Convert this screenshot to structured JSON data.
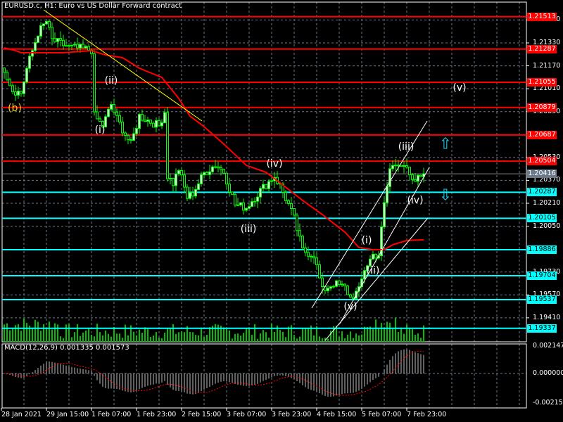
{
  "header": {
    "title": "EURUSD.c, H1:  Euro vs US Dollar Forward contract"
  },
  "macd_header": {
    "title": "MACD(12,26,9) 0.001335 0.001573"
  },
  "chart_data": {
    "type": "candlestick",
    "symbol": "EURUSD.c",
    "timeframe": "H1",
    "bars": 150,
    "close_path": [
      [
        0,
        1.2115
      ],
      [
        3,
        1.21
      ],
      [
        6,
        1.2098
      ],
      [
        8,
        1.2115
      ],
      [
        12,
        1.214
      ],
      [
        15,
        1.2148
      ],
      [
        17,
        1.2135
      ],
      [
        23,
        1.213
      ],
      [
        31,
        1.2128
      ],
      [
        32,
        1.2082
      ],
      [
        35,
        1.2075
      ],
      [
        38,
        1.209
      ],
      [
        40,
        1.208
      ],
      [
        45,
        1.2062
      ],
      [
        48,
        1.2082
      ],
      [
        55,
        1.2075
      ],
      [
        57,
        1.2085
      ],
      [
        58,
        1.204
      ],
      [
        60,
        1.2035
      ],
      [
        62,
        1.2045
      ],
      [
        65,
        1.2025
      ],
      [
        67,
        1.2028
      ],
      [
        71,
        1.2042
      ],
      [
        75,
        1.2048
      ],
      [
        78,
        1.2043
      ],
      [
        82,
        1.202
      ],
      [
        86,
        1.2018
      ],
      [
        91,
        1.203
      ],
      [
        96,
        1.204
      ],
      [
        98,
        1.2033
      ],
      [
        101,
        1.202
      ],
      [
        103,
        1.201
      ],
      [
        106,
        1.1988
      ],
      [
        110,
        1.1985
      ],
      [
        113,
        1.196
      ],
      [
        117,
        1.1965
      ],
      [
        121,
        1.1962
      ],
      [
        123,
        1.1955
      ],
      [
        126,
        1.196
      ],
      [
        128,
        1.1975
      ],
      [
        131,
        1.1985
      ],
      [
        133,
        1.1985
      ],
      [
        135,
        1.202
      ],
      [
        137,
        1.2045
      ],
      [
        140,
        1.205
      ],
      [
        142,
        1.2048
      ],
      [
        145,
        1.2035
      ],
      [
        148,
        1.204
      ],
      [
        149,
        1.20416
      ]
    ],
    "moving_average": {
      "color": "#ff0000",
      "points": [
        [
          0,
          1.21296
        ],
        [
          4,
          1.21276
        ],
        [
          6,
          1.21261
        ],
        [
          21,
          1.21261
        ],
        [
          31,
          1.21276
        ],
        [
          36,
          1.21246
        ],
        [
          42,
          1.21227
        ],
        [
          48,
          1.21153
        ],
        [
          56,
          1.21089
        ],
        [
          62,
          1.20942
        ],
        [
          66,
          1.20819
        ],
        [
          71,
          1.20745
        ],
        [
          78,
          1.20623
        ],
        [
          86,
          1.20475
        ],
        [
          93,
          1.20426
        ],
        [
          98,
          1.20352
        ],
        [
          106,
          1.2023
        ],
        [
          113,
          1.20131
        ],
        [
          121,
          1.20009
        ],
        [
          126,
          1.19901
        ],
        [
          131,
          1.19886
        ],
        [
          135,
          1.19886
        ],
        [
          138,
          1.1992
        ],
        [
          143,
          1.1995
        ],
        [
          149,
          1.19955
        ]
      ]
    },
    "resistance_levels": [
      "1.21513",
      "1.21287",
      "1.21055",
      "1.20879",
      "1.20687",
      "1.20504"
    ],
    "support_levels": [
      "1.20287",
      "1.20105",
      "1.19886",
      "1.19704",
      "1.19537",
      "1.19337"
    ],
    "current_price": "1.20416",
    "price_ticks": [
      "1.21490",
      "1.21330",
      "1.21170",
      "1.21010",
      "1.20850",
      "1.20530",
      "1.20370",
      "1.20210",
      "1.20050",
      "1.19730",
      "1.19570",
      "1.19410"
    ],
    "macd_ticks": [
      "0.002147",
      "0.000000",
      "-0.002154"
    ],
    "time_labels": [
      "28 Jan 2021",
      "29 Jan 15:00",
      "1 Feb 07:00",
      "1 Feb 23:00",
      "2 Feb 15:00",
      "3 Feb 07:00",
      "3 Feb 23:00",
      "4 Feb 15:00",
      "5 Feb 07:00",
      "7 Feb 23:00"
    ],
    "wave_labels": [
      "(b)",
      "(ii)",
      "(i)",
      "(iv)",
      "(iii)",
      "(v)",
      "(i)",
      "(ii)",
      "(iii)",
      "(iv)",
      "(v)"
    ],
    "colors": {
      "resistance": "#ff0000",
      "support": "#00ffff",
      "candles": "#00ff00",
      "trendline": "#ffff00",
      "channel": "#ffffff",
      "signal": "#ff0000",
      "histogram": "#c0c0c0"
    }
  }
}
